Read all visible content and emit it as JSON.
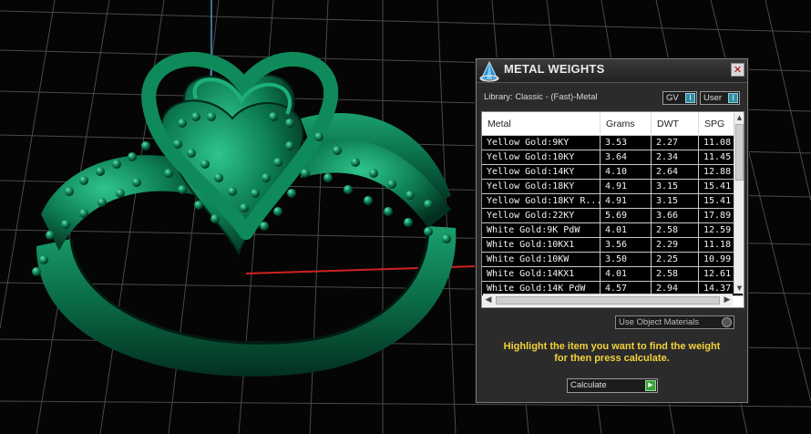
{
  "window": {
    "title": "METAL WEIGHTS",
    "close_glyph": "✕",
    "logo_icon": "pyramid-logo-icon"
  },
  "library": {
    "label": "Library: Classic - (Fast)-Metal",
    "toggles": [
      {
        "label": "GV",
        "indicator": "I"
      },
      {
        "label": "User",
        "indicator": "I"
      }
    ]
  },
  "table": {
    "columns": [
      "Metal",
      "Grams",
      "DWT",
      "SPG"
    ],
    "rows": [
      [
        "Yellow Gold:9KY",
        "3.53",
        "2.27",
        "11.08"
      ],
      [
        "Yellow Gold:10KY",
        "3.64",
        "2.34",
        "11.45"
      ],
      [
        "Yellow Gold:14KY",
        "4.10",
        "2.64",
        "12.88"
      ],
      [
        "Yellow Gold:18KY",
        "4.91",
        "3.15",
        "15.41"
      ],
      [
        "Yellow Gold:18KY R...",
        "4.91",
        "3.15",
        "15.41"
      ],
      [
        "Yellow Gold:22KY",
        "5.69",
        "3.66",
        "17.89"
      ],
      [
        "White Gold:9K PdW",
        "4.01",
        "2.58",
        "12.59"
      ],
      [
        "White Gold:10KX1",
        "3.56",
        "2.29",
        "11.18"
      ],
      [
        "White Gold:10KW",
        "3.50",
        "2.25",
        "10.99"
      ],
      [
        "White Gold:14KX1",
        "4.01",
        "2.58",
        "12.61"
      ],
      [
        "White Gold:14K PdW",
        "4.57",
        "2.94",
        "14.37"
      ]
    ]
  },
  "use_object_materials": {
    "label": "Use Object Materials"
  },
  "instructions": {
    "line1": "Highlight the item you want to find the weight",
    "line2": "for then press calculate."
  },
  "calculate": {
    "label": "Calculate",
    "icon": "play-arrow-icon"
  },
  "colors": {
    "accent_yellow": "#f2d23a",
    "ring_green": "#0b7a52",
    "grid": "#4a4a4a",
    "axis_blue": "#3aa0c8",
    "axis_red": "#d02020"
  }
}
